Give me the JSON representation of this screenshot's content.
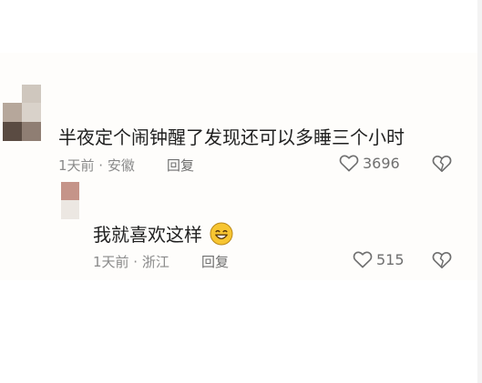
{
  "comments": [
    {
      "text": "半夜定个闹钟醒了发现还可以多睡三个小时",
      "time_location": "1天前 · 安徽",
      "reply_label": "回复",
      "likes": "3696"
    }
  ],
  "replies": [
    {
      "text": "我就喜欢这样",
      "emoji": "grinning-face-emoji",
      "time_location": "1天前 · 浙江",
      "reply_label": "回复",
      "likes": "515"
    }
  ],
  "icons": {
    "like": "heart-outline-icon",
    "dislike": "broken-heart-icon"
  },
  "colors": {
    "text": "#1f1f1f",
    "meta": "#8a8a8a",
    "icon": "#6f6f6f",
    "emoji_face": "#f7c531"
  }
}
